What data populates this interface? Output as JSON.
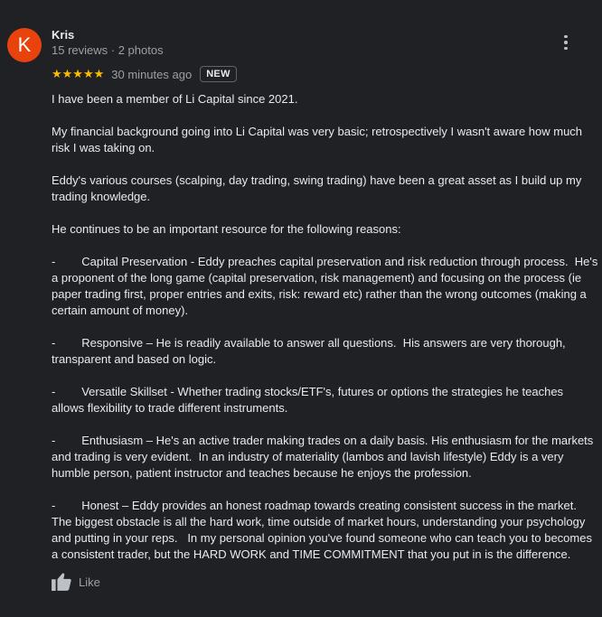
{
  "review": {
    "avatar_letter": "K",
    "author_name": "Kris",
    "author_meta": "15 reviews · 2 photos",
    "stars": "★★★★★",
    "rating": 5,
    "time_ago": "30 minutes ago",
    "badge": "NEW",
    "paragraphs": [
      "I have been a member of Li Capital since 2021.",
      "My financial background going into Li Capital was very basic; retrospectively I wasn't aware how much risk I was taking on.",
      "Eddy's various courses (scalping, day trading, swing trading) have been a great asset as I build up my trading knowledge.",
      "He continues to be an important resource for the following reasons:",
      "-        Capital Preservation - Eddy preaches capital preservation and risk reduction through process.  He's a proponent of the long game (capital preservation, risk management) and focusing on the process (ie paper trading first, proper entries and exits, risk: reward etc) rather than the wrong outcomes (making a certain amount of money).",
      "-        Responsive – He is readily available to answer all questions.  His answers are very thorough, transparent and based on logic.",
      "-        Versatile Skillset - Whether trading stocks/ETF's, futures or options the strategies he teaches allows flexibility to trade different instruments.",
      "-        Enthusiasm – He's an active trader making trades on a daily basis. His enthusiasm for the markets and trading is very evident.  In an industry of materiality (lambos and lavish lifestyle) Eddy is a very humble person, patient instructor and teaches because he enjoys the profession.",
      "-        Honest – Eddy provides an honest roadmap towards creating consistent success in the market.  The biggest obstacle is all the hard work, time outside of market hours, understanding your psychology and putting in your reps.   In my personal opinion you've found someone who can teach you to becomes a consistent trader, but the HARD WORK and TIME COMMITMENT that you put in is the difference."
    ],
    "like_label": "Like",
    "icons": {
      "menu": "more-vert-icon",
      "like": "thumb-up-icon"
    },
    "colors": {
      "background": "#202124",
      "avatar": "#e8430d",
      "stars": "#fbbc04",
      "text": "#e8eaed",
      "muted": "#9aa0a6"
    }
  }
}
